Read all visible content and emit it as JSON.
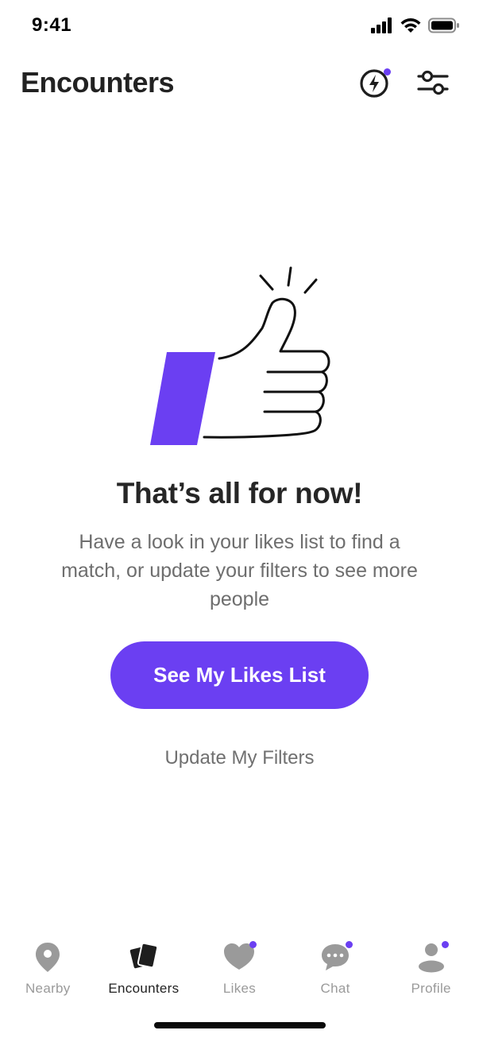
{
  "status_bar": {
    "time": "9:41"
  },
  "header": {
    "title": "Encounters"
  },
  "empty_state": {
    "title": "That’s all for now!",
    "description": "Have a look in your likes list to find a match, or update your filters to see more people",
    "primary_button": "See My Likes List",
    "secondary_link": "Update My Filters"
  },
  "tabs": [
    {
      "label": "Nearby",
      "icon": "location-pin-icon",
      "active": false
    },
    {
      "label": "Encounters",
      "icon": "cards-icon",
      "active": true
    },
    {
      "label": "Likes",
      "icon": "heart-icon",
      "active": false
    },
    {
      "label": "Chat",
      "icon": "chat-bubble-icon",
      "active": false
    },
    {
      "label": "Profile",
      "icon": "person-icon",
      "active": false
    }
  ],
  "colors": {
    "accent": "#6b3ff2",
    "text_primary": "#262626",
    "text_secondary": "#6e6e6e",
    "tab_inactive": "#9a9a9a"
  }
}
